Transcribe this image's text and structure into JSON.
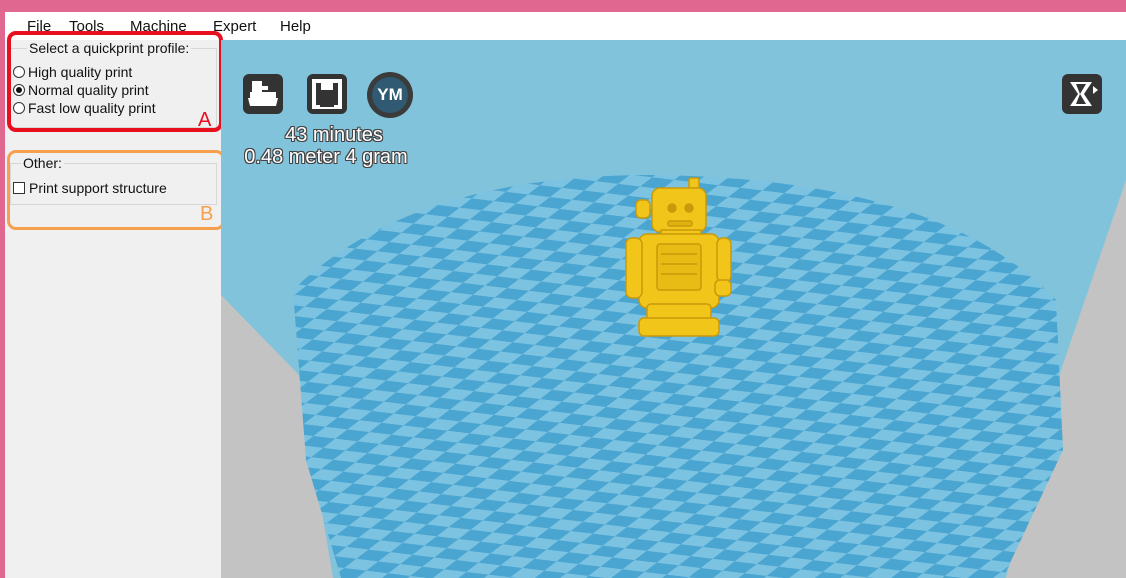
{
  "menubar": {
    "items": [
      "File",
      "Tools",
      "Machine",
      "Expert",
      "Help"
    ]
  },
  "sidebar": {
    "quickprint": {
      "legend": "Select a quickprint profile:",
      "options": [
        {
          "label": "High quality print",
          "selected": false
        },
        {
          "label": "Normal quality print",
          "selected": true
        },
        {
          "label": "Fast low quality print",
          "selected": false
        }
      ]
    },
    "other": {
      "legend": "Other:",
      "support_label": "Print support structure",
      "support_checked": false
    }
  },
  "annotations": {
    "a": {
      "letter": "A",
      "color": "#e8101e"
    },
    "b": {
      "letter": "B",
      "color": "#f6a04e"
    }
  },
  "viewport": {
    "toolbar_icons": [
      "load-model-icon",
      "save-icon",
      "ym-icon"
    ],
    "ym_label": "YM",
    "print_time": "43 minutes",
    "print_material": "0.48 meter 4 gram",
    "view_mode_icon": "view-mode-icon",
    "colors": {
      "background": "#82c3dc",
      "checker_light": "#7cc3e2",
      "checker_dark": "#4ba5d1",
      "floor_gray": "#c3c3c3",
      "model": "#f2c51a"
    }
  }
}
